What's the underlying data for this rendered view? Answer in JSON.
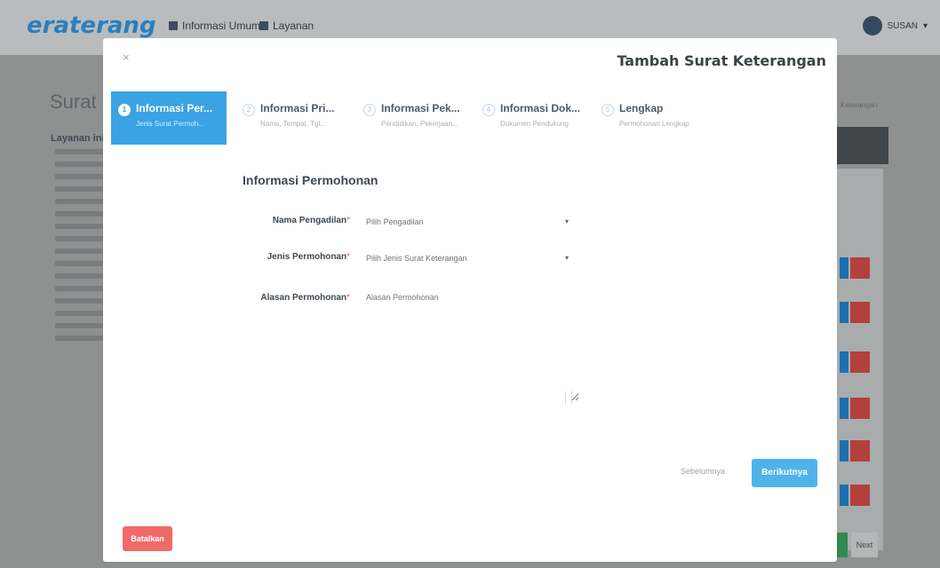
{
  "background": {
    "logo": "eraterang",
    "nav": [
      "Informasi Umum",
      "Layanan"
    ],
    "user": "SUSAN",
    "page_title": "Surat K",
    "sidebar_title": "Layanan ini",
    "crumb": "Keterangan",
    "next_button": "Next"
  },
  "modal": {
    "title": "Tambah Surat Keterangan",
    "close": "×",
    "steps": [
      {
        "num": "1",
        "title": "Informasi Per...",
        "subtitle": "Jenis Surat Permoh..."
      },
      {
        "num": "2",
        "title": "Informasi Pri...",
        "subtitle": "Nama, Tempat, Tgl..."
      },
      {
        "num": "3",
        "title": "Informasi Pek...",
        "subtitle": "Pendidikan, Pekerjaan..."
      },
      {
        "num": "4",
        "title": "Informasi Dok...",
        "subtitle": "Dokumen Pendukung"
      },
      {
        "num": "5",
        "title": "Lengkap",
        "subtitle": "Permohonan Lengkap"
      }
    ],
    "section_title": "Informasi Permohonan",
    "fields": {
      "pengadilan": {
        "label": "Nama Pengadilan",
        "value": "Pilih Pengadilan"
      },
      "jenis": {
        "label": "Jenis Permohonan",
        "value": "Pilih Jenis Surat Keterangan"
      },
      "alasan": {
        "label": "Alasan Permohonan",
        "placeholder": "Alasan Permohonan"
      }
    },
    "buttons": {
      "prev": "Sebelumnya",
      "next": "Berikutnya",
      "cancel": "Batalkan"
    }
  }
}
